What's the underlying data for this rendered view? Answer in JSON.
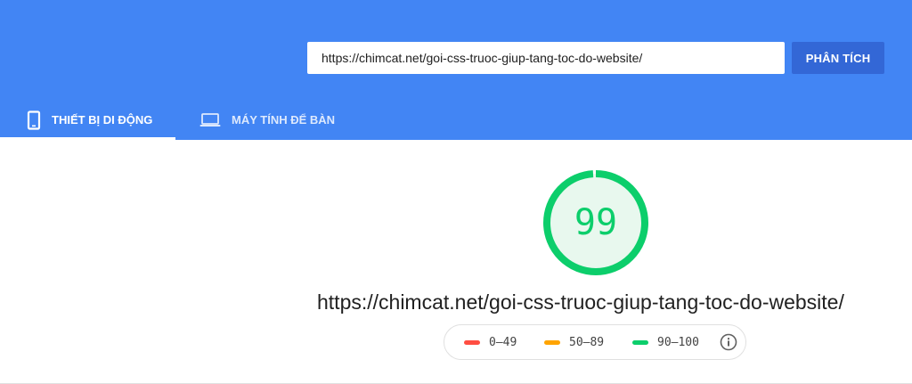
{
  "search": {
    "url_value": "https://chimcat.net/goi-css-truoc-giup-tang-toc-do-website/",
    "analyze_label": "PHÂN TÍCH"
  },
  "tabs": [
    {
      "label": "THIẾT BỊ DI ĐỘNG",
      "icon": "smartphone-icon",
      "active": true
    },
    {
      "label": "MÁY TÍNH ĐỂ BÀN",
      "icon": "laptop-icon",
      "active": false
    }
  ],
  "result": {
    "score": "99",
    "score_fraction": 0.99,
    "url": "https://chimcat.net/goi-css-truoc-giup-tang-toc-do-website/"
  },
  "legend": [
    {
      "label": "0–49",
      "color": "#ff4e42"
    },
    {
      "label": "50–89",
      "color": "#ffa400"
    },
    {
      "label": "90–100",
      "color": "#0cce6b"
    }
  ],
  "colors": {
    "header_bg": "#4285f4",
    "button_bg": "#3367d6",
    "pass_green": "#0cce6b",
    "gauge_fill": "#e8f8ee"
  },
  "legend_info_icon": "info-icon"
}
